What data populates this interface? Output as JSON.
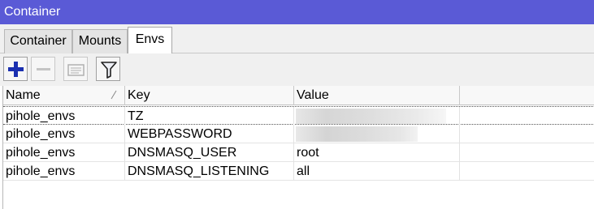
{
  "window": {
    "title": "Container"
  },
  "tabs": [
    {
      "label": "Container",
      "active": false
    },
    {
      "label": "Mounts",
      "active": false
    },
    {
      "label": "Envs",
      "active": true
    }
  ],
  "toolbar": {
    "add": "plus-icon",
    "remove": "minus-icon",
    "comment": "comment-icon",
    "filter": "filter-icon"
  },
  "table": {
    "columns": [
      "Name",
      "Key",
      "Value"
    ],
    "rows": [
      {
        "name": "pihole_envs",
        "key": "TZ",
        "value": ""
      },
      {
        "name": "pihole_envs",
        "key": "WEBPASSWORD",
        "value": ""
      },
      {
        "name": "pihole_envs",
        "key": "DNSMASQ_USER",
        "value": "root"
      },
      {
        "name": "pihole_envs",
        "key": "DNSMASQ_LISTENING",
        "value": "all"
      }
    ]
  },
  "colors": {
    "titlebar": "#5a5ad6",
    "accent_icon": "#1a2fb0"
  }
}
